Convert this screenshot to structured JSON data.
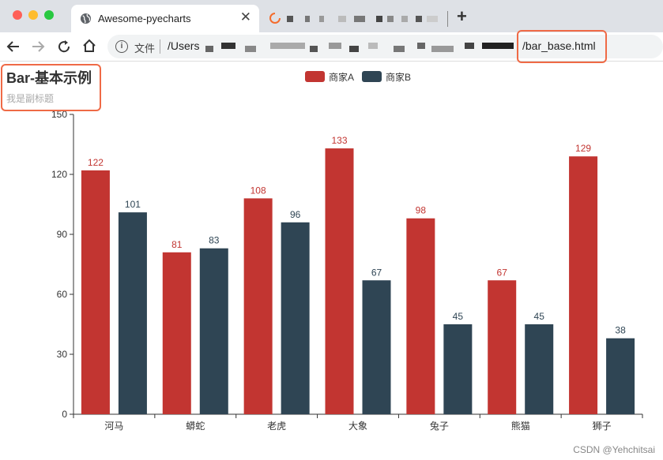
{
  "browser": {
    "tab_title": "Awesome-pyecharts",
    "tab_close": "✕",
    "new_tab": "+",
    "file_label": "文件",
    "url_start": "/Users",
    "url_end": "/bar_base.html"
  },
  "watermark": "CSDN @Yehchitsai",
  "colors": {
    "series_a": "#c23531",
    "series_b": "#2f4554",
    "highlight": "#ef6a46"
  },
  "chart_data": {
    "type": "bar",
    "title": "Bar-基本示例",
    "subtitle": "我是副标题",
    "categories": [
      "河马",
      "蟒蛇",
      "老虎",
      "大象",
      "兔子",
      "熊猫",
      "狮子"
    ],
    "series": [
      {
        "name": "商家A",
        "values": [
          122,
          81,
          108,
          133,
          98,
          67,
          129
        ]
      },
      {
        "name": "商家B",
        "values": [
          101,
          83,
          96,
          67,
          45,
          45,
          38
        ]
      }
    ],
    "yticks": [
      "0",
      "30",
      "60",
      "90",
      "120",
      "150"
    ],
    "ylim": [
      0,
      150
    ],
    "legend_position": "top-center",
    "grid": false
  }
}
